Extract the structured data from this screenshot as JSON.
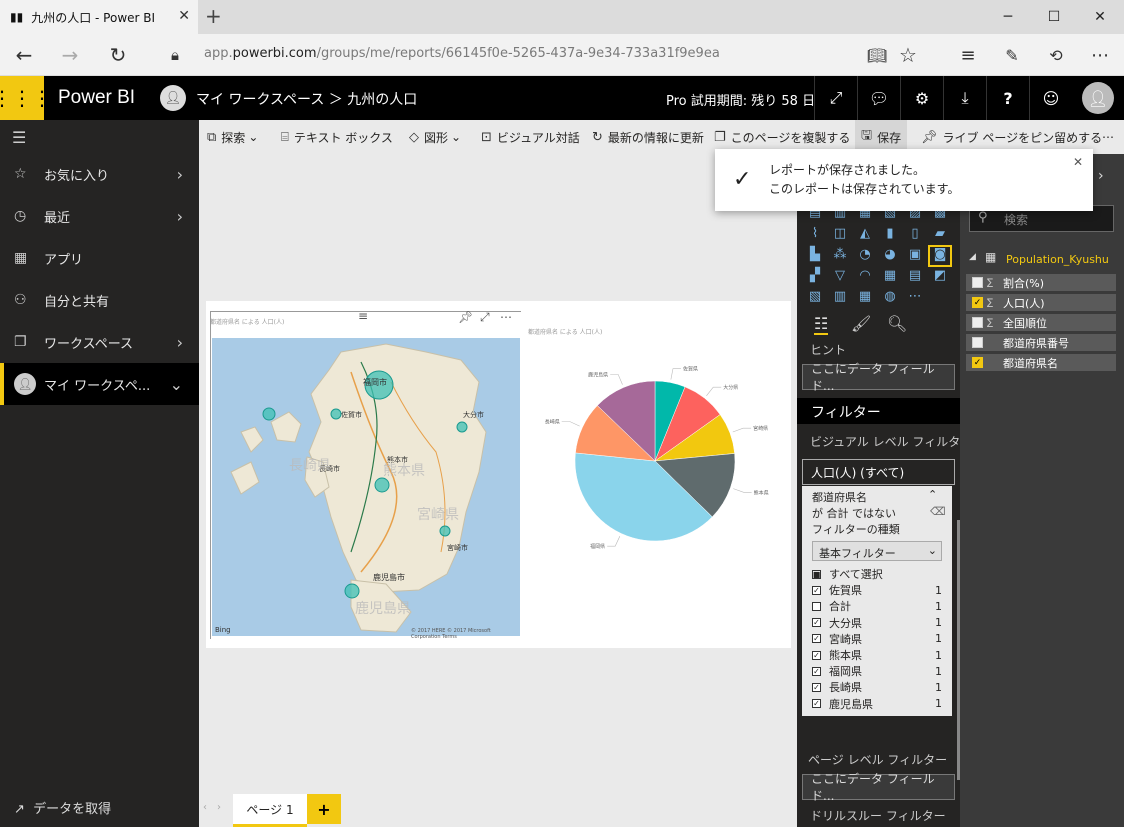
{
  "browser": {
    "tab_title": "九州の人口 - Power BI",
    "url_prefix": "app.",
    "url_domain": "powerbi.com",
    "url_path": "/groups/me/reports/66145f0e-5265-437a-9e34-733a31f9e9ea"
  },
  "header": {
    "brand": "Power BI",
    "breadcrumb": "マイ ワークスペース ＞ 九州の人口",
    "trial": "Pro 試用期間: 残り 58 日"
  },
  "leftnav": {
    "items": [
      {
        "label": "お気に入り"
      },
      {
        "label": "最近"
      },
      {
        "label": "アプリ"
      },
      {
        "label": "自分と共有"
      },
      {
        "label": "ワークスペース"
      },
      {
        "label": "マイ ワークスペ..."
      }
    ],
    "get_data": "データを取得"
  },
  "toolbar": {
    "explore": "探索",
    "textbox": "テキスト ボックス",
    "shapes": "図形",
    "qa": "ビジュアル対話",
    "refresh": "最新の情報に更新",
    "duplicate": "このページを複製する",
    "save": "保存",
    "pin": "ライブ ページをピン留めする"
  },
  "toast": {
    "line1": "レポートが保存されました。",
    "line2": "このレポートは保存されています。"
  },
  "visuals": {
    "map_title": "都道府県名 による 人口(人)",
    "pie_title": "都道府県名 による 人口(人)",
    "map_cities": [
      {
        "name": "福岡市"
      },
      {
        "name": "佐賀市"
      },
      {
        "name": "長崎市"
      },
      {
        "name": "大分市"
      },
      {
        "name": "熊本市"
      },
      {
        "name": "宮崎市"
      },
      {
        "name": "鹿児島市"
      }
    ],
    "map_regions": [
      {
        "name": "長崎県"
      },
      {
        "name": "熊本県"
      },
      {
        "name": "宮崎県"
      },
      {
        "name": "鹿児島県"
      }
    ],
    "bing": "Bing",
    "map_copyright": "© 2017 HERE © 2017 Microsoft Corporation Terms"
  },
  "chart_data": {
    "type": "pie",
    "slices": [
      {
        "label": "佐賀県",
        "value": 5.5,
        "color": "#01b8aa"
      },
      {
        "label": "大分県",
        "value": 8.1,
        "color": "#fd625e"
      },
      {
        "label": "宮崎県",
        "value": 7.5,
        "color": "#f2c80f"
      },
      {
        "label": "熊本県",
        "value": 12.4,
        "color": "#5f6b6d"
      },
      {
        "label": "福岡県",
        "value": 35.3,
        "color": "#8ad4eb"
      },
      {
        "label": "長崎県",
        "value": 9.5,
        "color": "#fe9666"
      },
      {
        "label": "鹿児島県",
        "value": 11.5,
        "color": "#a66999"
      }
    ]
  },
  "vizpane": {
    "values_hint": "ヒント",
    "values_drop": "ここにデータ フィールド...",
    "filters_title": "フィルター",
    "visual_level": "ビジュアル レベル フィルタ...",
    "population_filter": "人口(人) (すべて)",
    "filter_field": "都道府県名",
    "filter_not_total": "が 合計 ではない",
    "filter_type_label": "フィルターの種類",
    "filter_type_value": "基本フィルター",
    "filter_items": [
      {
        "label": "すべて選択",
        "count": "",
        "checked": "partial"
      },
      {
        "label": "佐賀県",
        "count": "1",
        "checked": "yes"
      },
      {
        "label": "合計",
        "count": "1",
        "checked": "no"
      },
      {
        "label": "大分県",
        "count": "1",
        "checked": "yes"
      },
      {
        "label": "宮崎県",
        "count": "1",
        "checked": "yes"
      },
      {
        "label": "熊本県",
        "count": "1",
        "checked": "yes"
      },
      {
        "label": "福岡県",
        "count": "1",
        "checked": "yes"
      },
      {
        "label": "長崎県",
        "count": "1",
        "checked": "yes"
      },
      {
        "label": "鹿児島県",
        "count": "1",
        "checked": "yes"
      }
    ],
    "page_level": "ページ レベル フィルター",
    "page_drop": "ここにデータ フィールド...",
    "drillthrough": "ドリルスルー フィルター"
  },
  "fields": {
    "search_placeholder": "検索",
    "table": "Population_Kyushu",
    "items": [
      {
        "label": "割合(%)",
        "sigma": "∑",
        "checked": false
      },
      {
        "label": "人口(人)",
        "sigma": "∑",
        "checked": true
      },
      {
        "label": "全国順位",
        "sigma": "∑",
        "checked": false
      },
      {
        "label": "都道府県番号",
        "sigma": "",
        "checked": false
      },
      {
        "label": "都道府県名",
        "sigma": "",
        "checked": true
      }
    ]
  },
  "pages": {
    "tab1": "ページ 1",
    "add": "+"
  }
}
